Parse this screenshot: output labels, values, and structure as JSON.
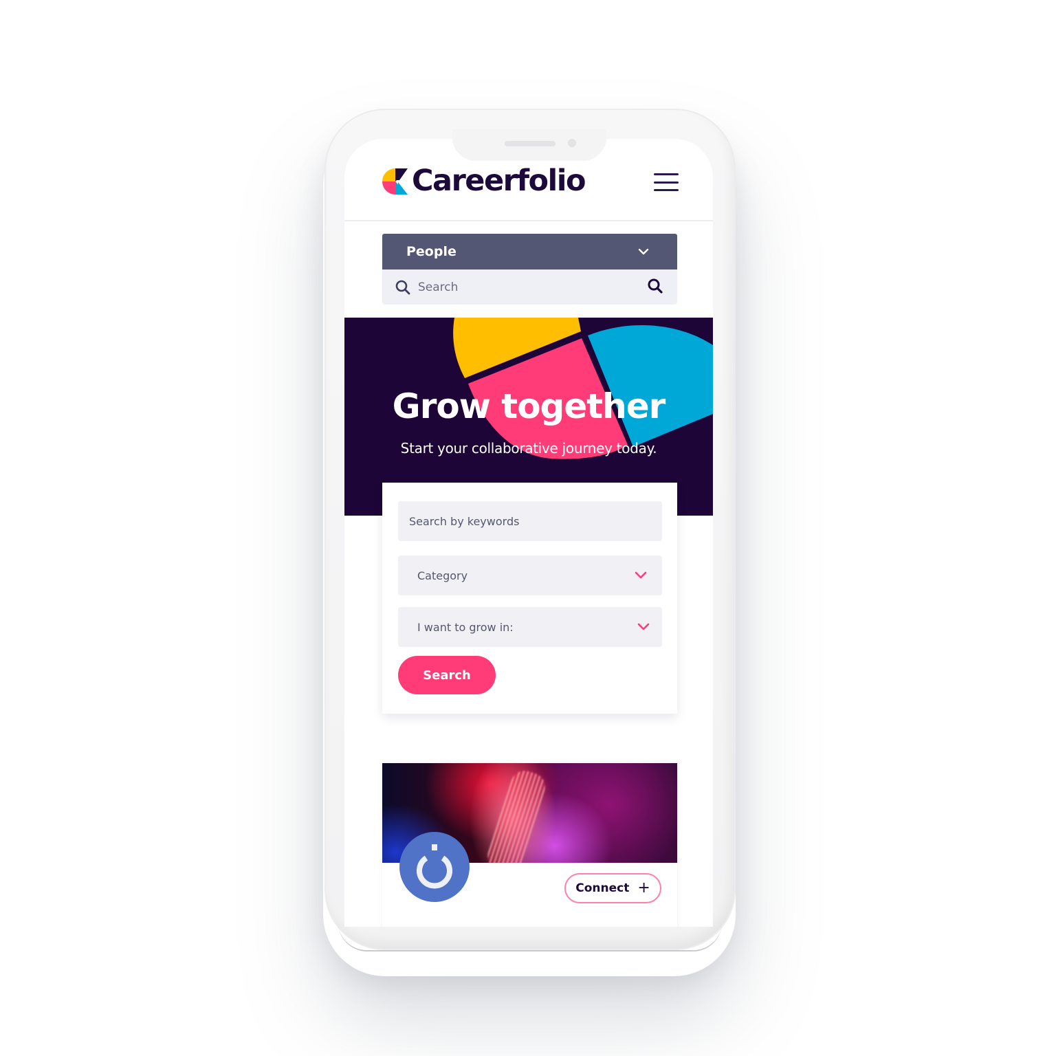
{
  "brand": {
    "name": "Careerfolio",
    "colors": {
      "navy": "#1e0538",
      "pink": "#ff3c78",
      "yellow": "#ffbe00",
      "cyan": "#00a8d8",
      "slate": "#545773",
      "field_bg": "#f0f0f5"
    }
  },
  "header": {
    "logo_text": "Careerfolio",
    "logo_icon": "careerfolio-logo-mark",
    "menu_icon": "hamburger-menu-icon"
  },
  "directory_select": {
    "selected": "People",
    "icon": "chevron-down-icon"
  },
  "top_search": {
    "placeholder": "Search",
    "lead_icon": "search-icon",
    "submit_icon": "search-icon"
  },
  "hero": {
    "title": "Grow together",
    "subtitle": "Start your collaborative journey today."
  },
  "search_form": {
    "keywords_placeholder": "Search by keywords",
    "category_label": "Category",
    "grow_label": "I want to grow in:",
    "submit_label": "Search"
  },
  "profile_card": {
    "avatar_icon": "power-icon",
    "connect_label": "Connect",
    "connect_icon": "plus-icon"
  }
}
